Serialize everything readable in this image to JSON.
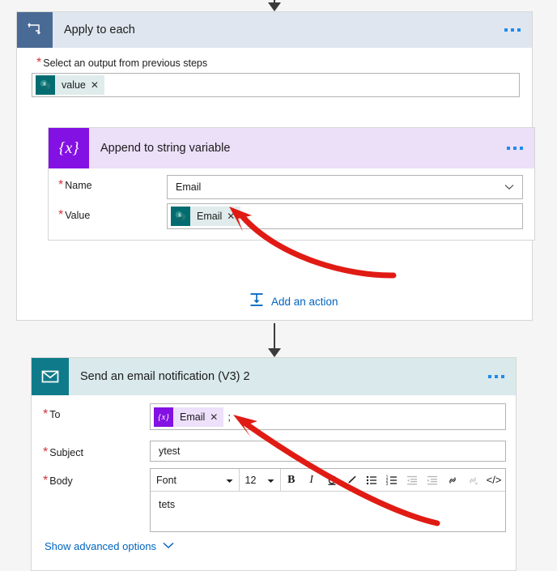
{
  "flow": {
    "top_connector": "down-arrow",
    "middle_connector": "down-arrow"
  },
  "apply_to_each": {
    "title": "Apply to each",
    "icon": "loop-icon",
    "ellipsis": "more-commands",
    "output_field": {
      "label": "Select an output from previous steps",
      "required": "*",
      "token": {
        "label": "value",
        "icon": "sharepoint-icon",
        "remove": "✕"
      }
    }
  },
  "append_variable": {
    "title": "Append to string variable",
    "icon": "variable-icon",
    "icon_glyph": "{x}",
    "ellipsis": "more-commands",
    "name_field": {
      "label": "Name",
      "required": "*",
      "value": "Email",
      "caret": "chevron-down-icon"
    },
    "value_field": {
      "label": "Value",
      "required": "*",
      "token": {
        "label": "Email",
        "icon": "sharepoint-icon",
        "remove": "✕"
      },
      "separator": ";"
    }
  },
  "add_action": {
    "label": "Add an action",
    "icon": "insert-action-icon"
  },
  "send_email": {
    "title": "Send an email notification (V3) 2",
    "icon": "envelope-icon",
    "ellipsis": "more-commands",
    "to_field": {
      "label": "To",
      "required": "*",
      "token": {
        "label": "Email",
        "icon": "variable-icon",
        "glyph": "{x}",
        "remove": "✕"
      },
      "separator": ";"
    },
    "subject_field": {
      "label": "Subject",
      "required": "*",
      "value": "ytest"
    },
    "body_field": {
      "label": "Body",
      "required": "*",
      "value": "tets",
      "toolbar": {
        "font_name": "Font",
        "font_size": "12",
        "buttons": [
          {
            "name": "bold-icon",
            "glyph": "B"
          },
          {
            "name": "italic-icon",
            "glyph": "I"
          },
          {
            "name": "underline-icon",
            "glyph": "U"
          },
          {
            "name": "highlighter-icon",
            "glyph": "pen"
          },
          {
            "name": "bulleted-list-icon",
            "glyph": "ul"
          },
          {
            "name": "numbered-list-icon",
            "glyph": "ol"
          },
          {
            "name": "decrease-indent-icon",
            "glyph": "outdent"
          },
          {
            "name": "increase-indent-icon",
            "glyph": "indent"
          },
          {
            "name": "insert-link-icon",
            "glyph": "link"
          },
          {
            "name": "remove-link-icon",
            "glyph": "unlink"
          },
          {
            "name": "code-view-icon",
            "glyph": "</>"
          }
        ]
      }
    },
    "advanced_link": {
      "label": "Show advanced options",
      "caret": "chevron-down-icon"
    }
  },
  "annotations": {
    "color": "#e01b14",
    "arrow_1": "points-to-value-field-semicolon",
    "arrow_2": "points-to-to-field-semicolon"
  }
}
